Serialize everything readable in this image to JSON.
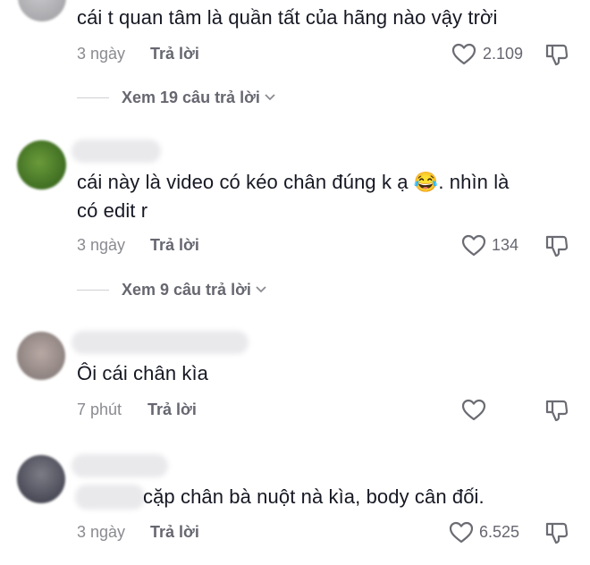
{
  "comments": [
    {
      "text": "cái t quan tâm là quần tất của hãng nào vậy trời",
      "time": "3 ngày",
      "reply_label": "Trả lời",
      "likes": "2.109",
      "view_replies": "Xem 19 câu trả lời"
    },
    {
      "text_line1": "cái này là video có kéo chân đúng k ạ",
      "emoji": "😂",
      "text_line1_end": ". nhìn là",
      "text_line2": "có edit r",
      "time": "3 ngày",
      "reply_label": "Trả lời",
      "likes": "134",
      "view_replies": "Xem 9 câu trả lời"
    },
    {
      "text": "Ôi cái chân kìa",
      "time": "7 phút",
      "reply_label": "Trả lời",
      "likes": ""
    },
    {
      "text": "cặp chân bà nuột nà kìa, body cân đối.",
      "time": "3 ngày",
      "reply_label": "Trả lời",
      "likes": "6.525"
    }
  ],
  "icons": {
    "like": "heart-icon",
    "dislike": "thumbs-down-icon",
    "expand": "chevron-down-icon"
  },
  "colors": {
    "text": "#161823",
    "muted": "#8a8b91",
    "secondary": "#666770",
    "divider": "#cfd0d4",
    "background": "#ffffff"
  }
}
